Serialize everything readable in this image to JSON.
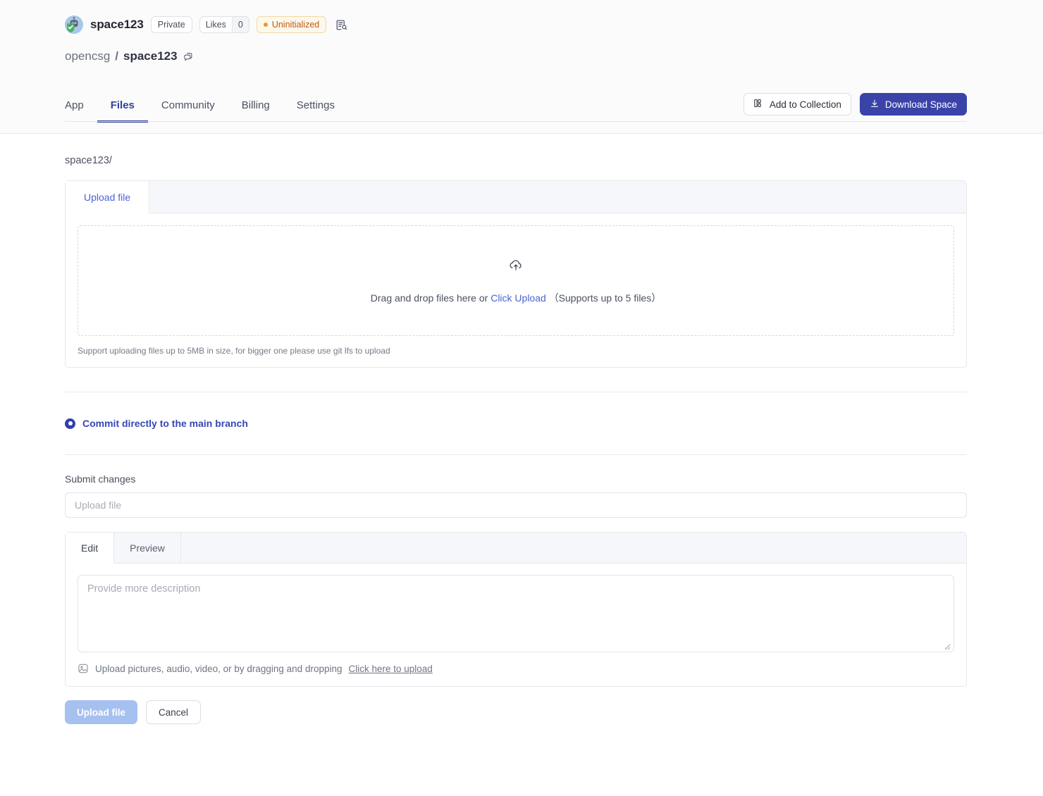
{
  "header": {
    "repo_name": "space123",
    "avatar_icon": "robot-shield-avatar",
    "visibility_label": "Private",
    "likes_label": "Likes",
    "likes_count": "0",
    "status_label": "Uninitialized",
    "status_color": "#c2590c",
    "logs_icon": "log-search-icon",
    "breadcrumb": {
      "owner": "opencsg",
      "separator": "/",
      "repo": "space123",
      "copy_icon": "copy-icon"
    },
    "tabs": [
      {
        "label": "App",
        "active": false
      },
      {
        "label": "Files",
        "active": true
      },
      {
        "label": "Community",
        "active": false
      },
      {
        "label": "Billing",
        "active": false
      },
      {
        "label": "Settings",
        "active": false
      }
    ],
    "actions": {
      "add_to_collection": "Add to Collection",
      "add_to_collection_icon": "collection-icon",
      "download_space": "Download Space",
      "download_icon": "download-icon",
      "primary_color": "#3a43a8"
    }
  },
  "main": {
    "path_crumb": "space123/",
    "upload_panel": {
      "tab_label": "Upload file",
      "dropzone_icon": "cloud-upload-icon",
      "dropzone_text_before": "Drag and drop files here or",
      "dropzone_link": "Click Upload",
      "dropzone_text_after": "（Supports up to 5 files）",
      "hint": "Support uploading files up to 5MB in size, for bigger one please use git lfs to upload"
    },
    "commit": {
      "radio_label": "Commit directly to the main branch",
      "selected": true
    },
    "submit": {
      "section_label": "Submit changes",
      "summary_value": "",
      "summary_placeholder": "Upload file",
      "editor_tabs": [
        {
          "label": "Edit",
          "active": true
        },
        {
          "label": "Preview",
          "active": false
        }
      ],
      "description_value": "",
      "description_placeholder": "Provide more description",
      "attach_icon": "image-icon",
      "attach_text": "Upload pictures, audio, video, or by dragging and dropping",
      "attach_link": "Click here to upload"
    },
    "footer": {
      "upload_button": "Upload file",
      "upload_disabled": true,
      "cancel_button": "Cancel"
    }
  }
}
